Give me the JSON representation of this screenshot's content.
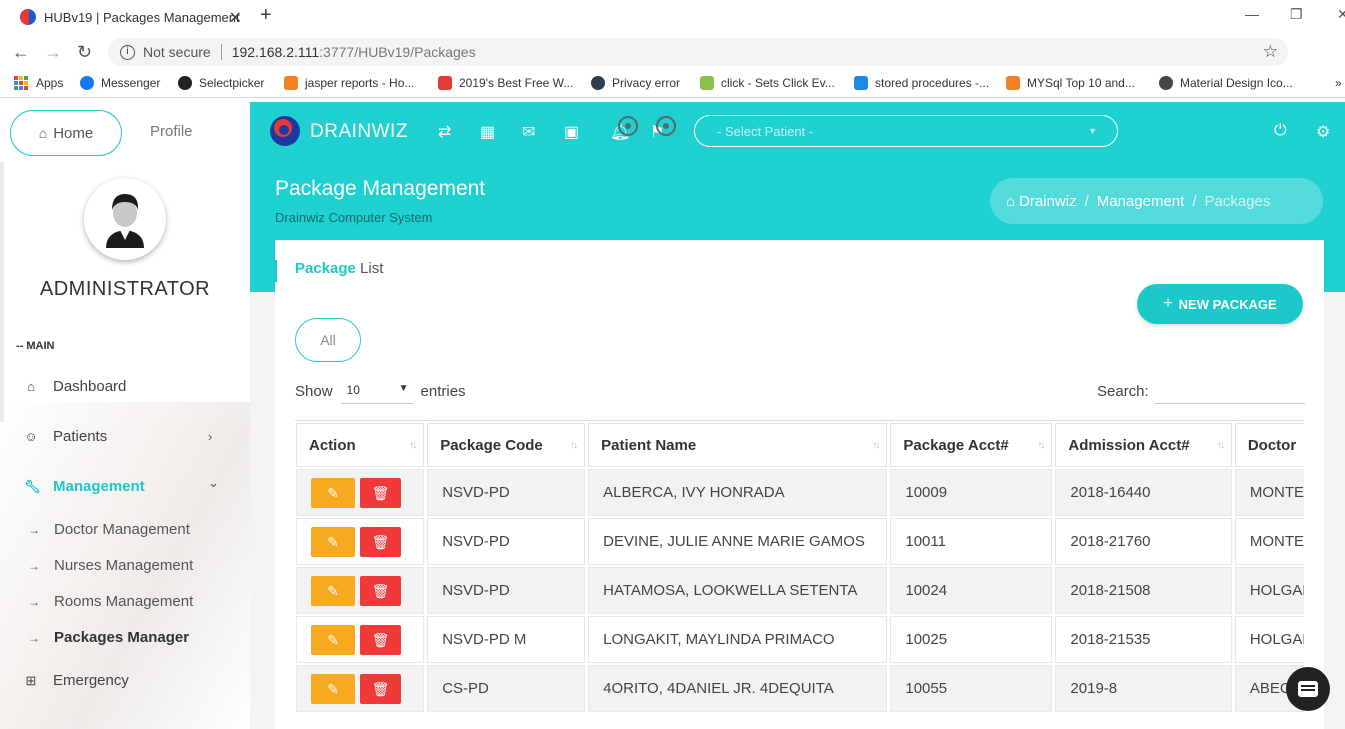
{
  "browser": {
    "tab_title": "HUBv19 | Packages Management",
    "tab_close": "✕",
    "new_tab": "+",
    "url_security": "Not secure",
    "url_host": "192.168.2.111",
    "url_path": ":3777/HUBv19/Packages",
    "bookmarks": [
      {
        "label": "Apps",
        "icon": "apps-grid-icon"
      },
      {
        "label": "Messenger",
        "icon": "messenger-icon",
        "color": "#1877f2"
      },
      {
        "label": "Selectpicker",
        "icon": "github-icon",
        "color": "#222222"
      },
      {
        "label": "jasper reports - Ho...",
        "icon": "stackoverflow-icon",
        "color": "#f48024"
      },
      {
        "label": "2019's Best Free W...",
        "icon": "swirl-icon",
        "color": "#e53935"
      },
      {
        "label": "Privacy error",
        "icon": "globe-icon",
        "color": "#2c3e50"
      },
      {
        "label": "click - Sets Click Ev...",
        "icon": "spark-icon",
        "color": "#8bc34a"
      },
      {
        "label": "stored procedures -...",
        "icon": "database-icon",
        "color": "#1e88e5"
      },
      {
        "label": "MYSql Top 10 and...",
        "icon": "stackoverflow-icon",
        "color": "#f48024"
      },
      {
        "label": "Material Design Ico...",
        "icon": "globe-icon",
        "color": "#444444"
      }
    ],
    "more_bookmarks": "»"
  },
  "sidebar": {
    "home_label": "Home",
    "profile_label": "Profile",
    "user_name": "ADMINISTRATOR",
    "section_label": "-- MAIN",
    "items": [
      {
        "label": "Dashboard",
        "icon": "home-icon"
      },
      {
        "label": "Patients",
        "icon": "patient-icon",
        "chevron": "›"
      },
      {
        "label": "Management",
        "icon": "wrench-icon",
        "chevron": "⌄"
      },
      {
        "label": "Emergency",
        "icon": "plus-square-icon"
      }
    ],
    "subitems": [
      {
        "label": "Doctor Management"
      },
      {
        "label": "Nurses Management"
      },
      {
        "label": "Rooms Management"
      },
      {
        "label": "Packages Manager"
      }
    ],
    "sub_arrow": "→"
  },
  "topbar": {
    "brand": "DRAINWIZ",
    "patient_placeholder": "- Select Patient -"
  },
  "page": {
    "title": "Package Management",
    "subtitle": "Drainwiz Computer System",
    "breadcrumb": [
      "Drainwiz",
      "Management",
      "Packages"
    ],
    "breadcrumb_sep": "/"
  },
  "card": {
    "title_bold": "Package",
    "title_rest": " List",
    "new_button": "NEW PACKAGE",
    "filter_all": "All",
    "show_label": "Show",
    "entries_value": "10",
    "entries_label": "entries",
    "search_label": "Search:"
  },
  "table": {
    "columns": [
      "Action",
      "Package  Code",
      "Patient  Name",
      "Package  Acct#",
      "Admission  Acct#",
      "Doctor"
    ],
    "rows": [
      {
        "code": "NSVD-PD",
        "patient": "ALBERCA, IVY HONRADA",
        "pkg_acct": "10009",
        "adm_acct": "2018-16440",
        "doctor": "MONTE, MELL"
      },
      {
        "code": "NSVD-PD",
        "patient": "DEVINE, JULIE ANNE MARIE GAMOS",
        "pkg_acct": "10011",
        "adm_acct": "2018-21760",
        "doctor": "MONTE, MELL"
      },
      {
        "code": "NSVD-PD",
        "patient": "HATAMOSA, LOOKWELLA SETENTA",
        "pkg_acct": "10024",
        "adm_acct": "2018-21508",
        "doctor": "HOLGANZA, A"
      },
      {
        "code": "NSVD-PD M",
        "patient": "LONGAKIT, MAYLINDA PRIMACO",
        "pkg_acct": "10025",
        "adm_acct": "2018-21535",
        "doctor": "HOLGANZA, A"
      },
      {
        "code": "CS-PD",
        "patient": "4ORITO, 4DANIEL JR. 4DEQUITA",
        "pkg_acct": "10055",
        "adm_acct": "2019-8",
        "doctor": "ABECIA, LE"
      }
    ]
  },
  "colors": {
    "accent": "#1fd0d0",
    "edit": "#f7a91f",
    "delete": "#f03a3a"
  }
}
